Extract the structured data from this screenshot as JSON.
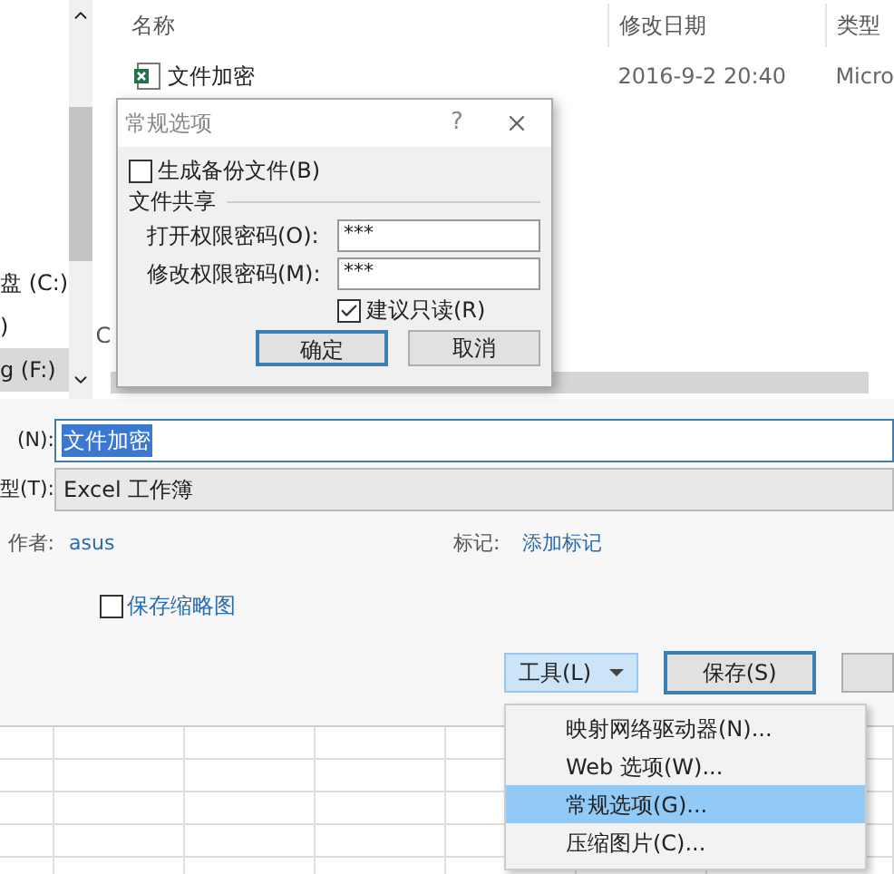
{
  "nav_pane": {
    "items": [
      {
        "label": "盘 (C:)",
        "selected": false
      },
      {
        "label": ")",
        "selected": false
      },
      {
        "label": "g (F:)",
        "selected": true
      }
    ]
  },
  "file_list": {
    "columns": [
      "名称",
      "修改日期",
      "类型"
    ],
    "rows": [
      {
        "name": "文件加密",
        "date": "2016-9-2 20:40",
        "type": "Micro"
      }
    ],
    "partial_text": "C"
  },
  "general_options_dialog": {
    "title": "常规选项",
    "help": "?",
    "backup": {
      "label": "生成备份文件(B)",
      "checked": false
    },
    "section": "文件共享",
    "fields": [
      {
        "label": "打开权限密码(O):",
        "value": "***"
      },
      {
        "label": "修改权限密码(M):",
        "value": "***"
      }
    ],
    "read_only": {
      "label": "建议只读(R)",
      "checked": true
    },
    "buttons": [
      {
        "label": "确定",
        "default": true
      },
      {
        "label": "取消",
        "default": false
      }
    ]
  },
  "save_form": {
    "filename_label": "(N):",
    "filename": "文件加密",
    "filetype_label": "型(T):",
    "filetype": "Excel 工作簿",
    "author_label": "作者:",
    "author": "asus",
    "tags_label": "标记:",
    "tags": "添加标记",
    "thumbnail": {
      "label": "保存缩略图",
      "checked": false
    }
  },
  "tools_button": "工具(L)",
  "save_button": "保存(S)",
  "tools_menu": [
    {
      "label": "映射网络驱动器(N)...",
      "selected": false
    },
    {
      "label": "Web 选项(W)...",
      "selected": false
    },
    {
      "label": "常规选项(G)...",
      "selected": true
    },
    {
      "label": "压缩图片(C)...",
      "selected": false
    }
  ]
}
